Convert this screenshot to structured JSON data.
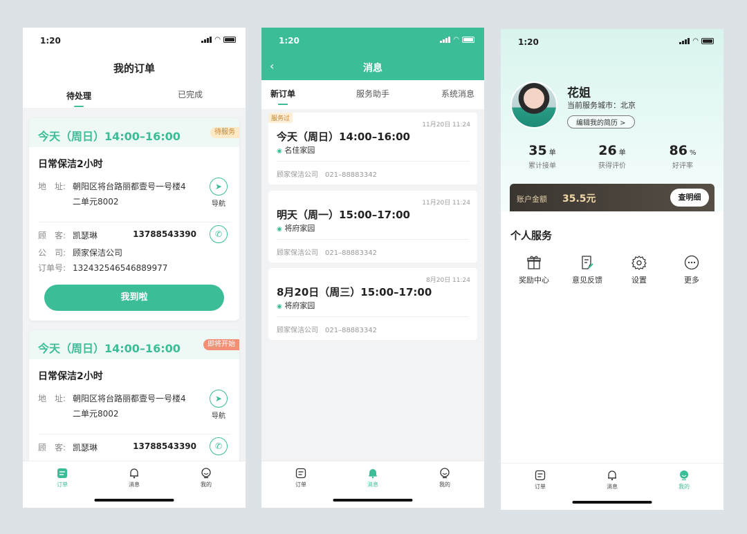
{
  "status": {
    "time": "1:20"
  },
  "orders_screen": {
    "title": "我的订单",
    "tabs": [
      "待处理",
      "已完成"
    ],
    "orders": [
      {
        "time": "今天（周日）14:00–16:00",
        "badge": "待服务",
        "service": "日常保洁2小时",
        "addr_label": "地　址:",
        "addr_line1": "朝阳区将台路丽都壹号一号楼4",
        "addr_line2": "二单元8002",
        "nav_label": "导航",
        "customer_label": "顾　客:",
        "customer": "凯瑟琳",
        "phone": "13788543390",
        "company_label": "公　司:",
        "company": "顾家保洁公司",
        "order_no_label": "订单号:",
        "order_no": "132432546546889977",
        "action": "我到啦"
      },
      {
        "time": "今天（周日）14:00–16:00",
        "badge": "即将开始",
        "service": "日常保洁2小时",
        "addr_label": "地　址:",
        "addr_line1": "朝阳区将台路丽都壹号一号楼4",
        "addr_line2": "二单元8002",
        "nav_label": "导航",
        "customer_label": "顾　客:",
        "customer": "凯瑟琳",
        "phone": "13788543390"
      }
    ]
  },
  "tabbar": {
    "orders": "订单",
    "messages": "消息",
    "mine": "我的"
  },
  "messages_screen": {
    "title": "消息",
    "tabs": [
      "新订单",
      "服务助手",
      "系统消息"
    ],
    "items": [
      {
        "tag": "服务过",
        "date": "11月20日  11:24",
        "time": "今天（周日）14:00–16:00",
        "place": "名佳家园",
        "company": "顾家保洁公司",
        "phone": "021–88883342"
      },
      {
        "tag": "",
        "date": "11月20日  11:24",
        "time": "明天（周一）15:00–17:00",
        "place": "将府家园",
        "company": "顾家保洁公司",
        "phone": "021–88883342"
      },
      {
        "tag": "",
        "date": "8月20日  11:24",
        "time": "8月20日（周三）15:00–17:00",
        "place": "将府家园",
        "company": "顾家保洁公司",
        "phone": "021–88883342"
      }
    ]
  },
  "profile_screen": {
    "name": "花姐",
    "city": "当前服务城市：北京",
    "edit": "编辑我的简历 >",
    "stats": [
      {
        "value": "35",
        "unit": "单",
        "label": "累计接单"
      },
      {
        "value": "26",
        "unit": "单",
        "label": "获得评价"
      },
      {
        "value": "86",
        "unit": "%",
        "label": "好评率"
      }
    ],
    "balance_label": "账户金额",
    "balance": "35.5元",
    "detail_button": "查明细",
    "section_title": "个人服务",
    "services": [
      {
        "label": "奖励中心",
        "icon": "gift-icon"
      },
      {
        "label": "意见反馈",
        "icon": "feedback-icon"
      },
      {
        "label": "设置",
        "icon": "gear-icon"
      },
      {
        "label": "更多",
        "icon": "more-icon"
      }
    ]
  },
  "colors": {
    "accent": "#3bbd98",
    "balance_bg": "#3a3530"
  }
}
